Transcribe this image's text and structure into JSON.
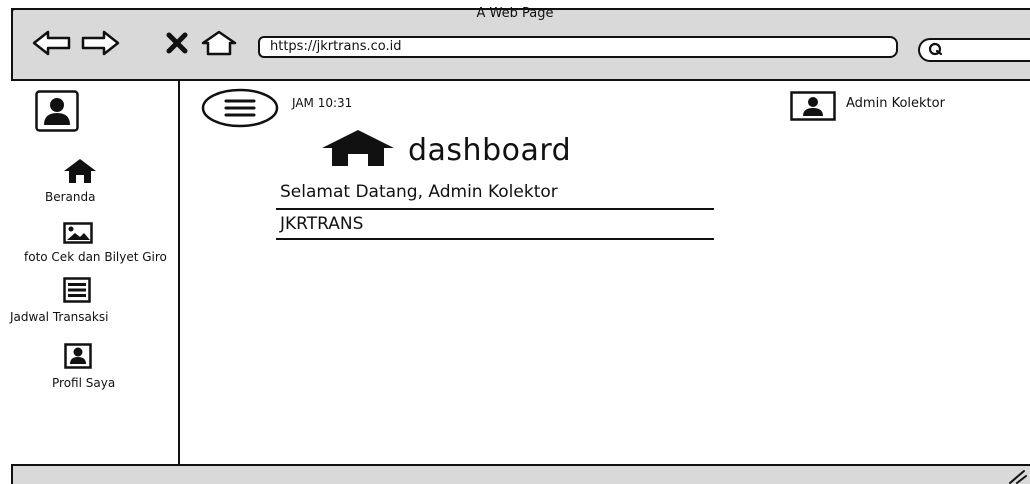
{
  "browser": {
    "page_title": "A Web Page",
    "url": "https://jkrtrans.co.id"
  },
  "icons": {
    "back": "back-arrow-icon",
    "forward": "forward-arrow-icon",
    "close": "close-icon",
    "home": "home-icon",
    "search": "search-icon",
    "menu": "hamburger-menu-icon",
    "user": "user-avatar-icon",
    "dashboard": "home-icon"
  },
  "sidebar": {
    "items": [
      {
        "label": "Beranda",
        "icon": "home-icon"
      },
      {
        "label": "foto Cek dan Bilyet Giro",
        "icon": "image-icon"
      },
      {
        "label": "Jadwal Transaksi",
        "icon": "list-icon"
      },
      {
        "label": "Profil Saya",
        "icon": "user-icon"
      }
    ]
  },
  "header": {
    "clock": "JAM 10:31",
    "user_name": "Admin Kolektor"
  },
  "main": {
    "title": "dashboard",
    "welcome": "Selamat Datang, Admin Kolektor",
    "company": "JKRTRANS"
  }
}
